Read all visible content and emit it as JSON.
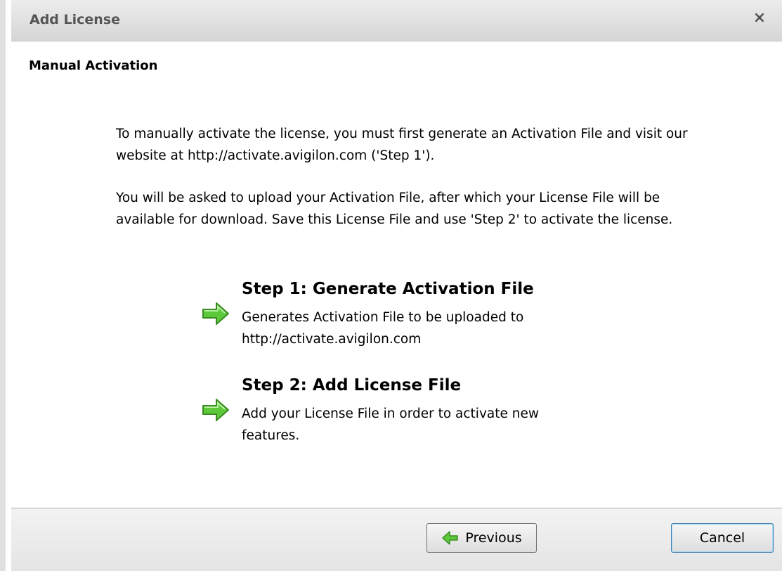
{
  "dialog": {
    "title": "Add License",
    "close_symbol": "×",
    "subtitle": "Manual Activation"
  },
  "paragraphs": [
    "To manually activate the license, you must first generate an Activation File and visit our website at http://activate.avigilon.com ('Step 1').",
    "You will be asked to upload your Activation File, after which your License File will be available for download. Save this License File and use 'Step 2' to activate the license."
  ],
  "steps": [
    {
      "title": "Step 1: Generate Activation File",
      "description": "Generates Activation File to be uploaded to http://activate.avigilon.com",
      "icon": "green-arrow-right-icon"
    },
    {
      "title": "Step 2: Add License File",
      "description": "Add your License File in order to activate new features.",
      "icon": "green-arrow-right-icon"
    }
  ],
  "buttons": {
    "previous": {
      "label": "Previous",
      "icon": "green-arrow-left-icon"
    },
    "cancel": {
      "label": "Cancel"
    }
  },
  "colors": {
    "arrow_fill": "#5cc83a",
    "arrow_stroke": "#3a8c22"
  }
}
